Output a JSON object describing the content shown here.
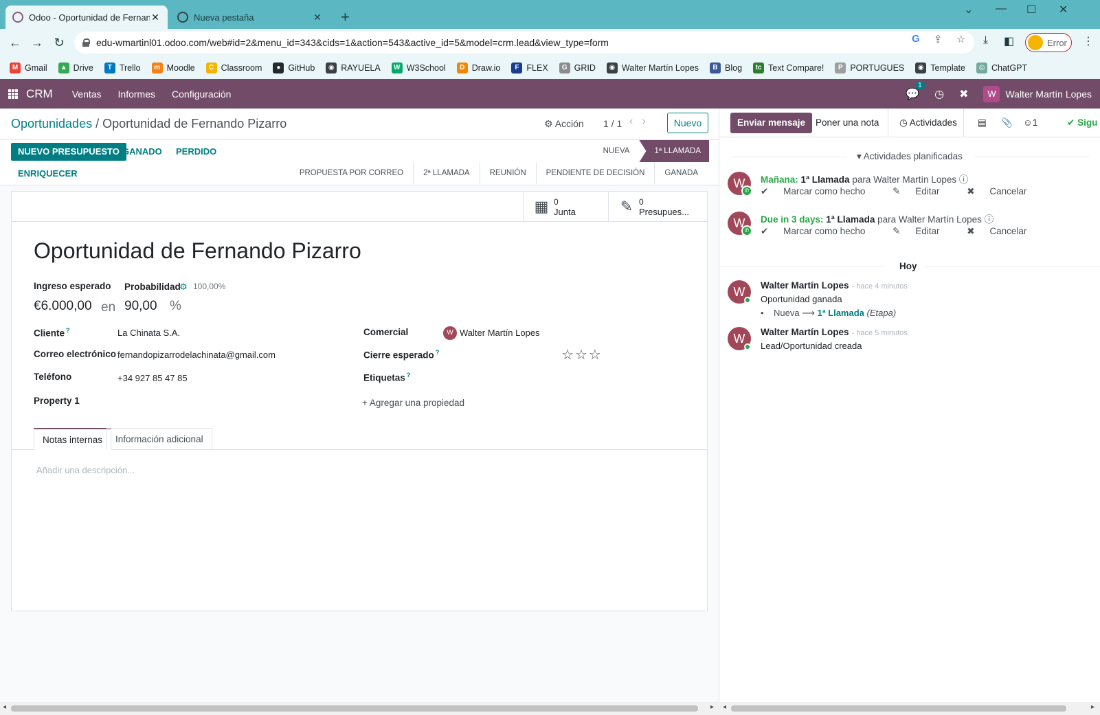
{
  "browser": {
    "tabs": [
      {
        "title": "Odoo - Oportunidad de Fernando Pizarro",
        "active": true
      },
      {
        "title": "Nueva pestaña",
        "active": false
      }
    ],
    "url": "edu-wmartinl01.odoo.com/web#id=2&menu_id=343&cids=1&action=543&active_id=5&model=crm.lead&view_type=form",
    "profile_label": "Error",
    "bookmarks": [
      {
        "label": "Gmail",
        "icon": "gmail-icon",
        "color": "#ea4335",
        "glyph": "M"
      },
      {
        "label": "Drive",
        "icon": "drive-icon",
        "color": "#34a853",
        "glyph": "▲"
      },
      {
        "label": "Trello",
        "icon": "trello-icon",
        "color": "#0079bf",
        "glyph": "T"
      },
      {
        "label": "Moodle",
        "icon": "moodle-icon",
        "color": "#f98012",
        "glyph": "m"
      },
      {
        "label": "Classroom",
        "icon": "classroom-icon",
        "color": "#f4b400",
        "glyph": "C"
      },
      {
        "label": "GitHub",
        "icon": "github-icon",
        "color": "#24292e",
        "glyph": "●"
      },
      {
        "label": "RAYUELA",
        "icon": "rayuela-icon",
        "color": "#3c4043",
        "glyph": "◉"
      },
      {
        "label": "W3School",
        "icon": "w3school-icon",
        "color": "#04aa6d",
        "glyph": "W"
      },
      {
        "label": "Draw.io",
        "icon": "drawio-icon",
        "color": "#f08705",
        "glyph": "D"
      },
      {
        "label": "FLEX",
        "icon": "flex-icon",
        "color": "#1a3d8f",
        "glyph": "F"
      },
      {
        "label": "GRID",
        "icon": "grid-icon",
        "color": "#8c8c8c",
        "glyph": "G"
      },
      {
        "label": "Walter Martín Lopes",
        "icon": "globe-icon",
        "color": "#3c4043",
        "glyph": "◉"
      },
      {
        "label": "Blog",
        "icon": "blog-icon",
        "color": "#3b5998",
        "glyph": "B"
      },
      {
        "label": "Text Compare!",
        "icon": "textcompare-icon",
        "color": "#2e7d32",
        "glyph": "tc"
      },
      {
        "label": "PORTUGUES",
        "icon": "portugues-icon",
        "color": "#9e9e9e",
        "glyph": "P"
      },
      {
        "label": "Template",
        "icon": "template-icon",
        "color": "#3c4043",
        "glyph": "◉"
      },
      {
        "label": "ChatGPT",
        "icon": "chatgpt-icon",
        "color": "#74aa9c",
        "glyph": "◎"
      }
    ]
  },
  "navbar": {
    "app": "CRM",
    "menus": [
      "Ventas",
      "Informes",
      "Configuración"
    ],
    "chat_badge": "1",
    "user_initial": "W",
    "user_name": "Walter Martín Lopes"
  },
  "control_panel": {
    "breadcrumb_parent": "Oportunidades",
    "breadcrumb_sep": "/",
    "breadcrumb_current": "Oportunidad de Fernando Pizarro",
    "action_label": "Acción",
    "pager": "1 / 1",
    "new_label": "Nuevo"
  },
  "statusbar": {
    "buttons": {
      "quote": "NUEVO PRESUPUESTO",
      "won": "GANADO",
      "lost": "PERDIDO",
      "enrich": "ENRIQUECER"
    },
    "stages_top": [
      "NUEVA",
      "1ª LLAMADA"
    ],
    "stages_bottom": [
      "PROPUESTA POR CORREO",
      "2ª LLAMADA",
      "REUNIÓN",
      "PENDIENTE DE DECISIÓN",
      "GANADA"
    ],
    "current_stage": "1ª LLAMADA",
    "current_color": "#714b67"
  },
  "smart_buttons": [
    {
      "value": "0",
      "label": "Junta",
      "icon": "calendar-icon"
    },
    {
      "value": "0",
      "label": "Presupues...",
      "icon": "edit-icon"
    }
  ],
  "form": {
    "title": "Oportunidad de Fernando Pizarro",
    "expected_revenue_label": "Ingreso esperado",
    "expected_revenue": "€6.000,00",
    "in_label": "en",
    "probability_label": "Probabilidad",
    "probability_auto": "100,00%",
    "probability": "90,00",
    "percent": "%",
    "customer_label": "Cliente",
    "customer": "La Chinata S.A.",
    "email_label": "Correo electrónico",
    "email": "fernandopizarrodelachinata@gmail.com",
    "phone_label": "Teléfono",
    "phone": "+34 927 85 47 85",
    "property_label": "Property 1",
    "salesperson_label": "Comercial",
    "salesperson_initial": "W",
    "salesperson": "Walter Martín Lopes",
    "deadline_label": "Cierre esperado",
    "tags_label": "Etiquetas",
    "add_property": "Agregar una propiedad",
    "priority_stars": 0,
    "tabs": [
      "Notas internas",
      "Información adicional"
    ],
    "description_placeholder": "Añadir una descripción..."
  },
  "chatter": {
    "send_message": "Enviar mensaje",
    "log_note": "Poner una nota",
    "activities": "Actividades",
    "followers_count": "1",
    "follow_label": "Sigu",
    "planned_header": "Actividades planificadas",
    "activities_list": [
      {
        "when": "Mañana:",
        "summary": "1ª Llamada",
        "for": "para Walter Martín Lopes",
        "done": "Marcar como hecho",
        "edit": "Editar",
        "cancel": "Cancelar",
        "initial": "W"
      },
      {
        "when": "Due in 3 days:",
        "summary": "1ª Llamada",
        "for": "para Walter Martín Lopes",
        "done": "Marcar como hecho",
        "edit": "Editar",
        "cancel": "Cancelar",
        "initial": "W"
      }
    ],
    "today_label": "Hoy",
    "messages": [
      {
        "author": "Walter Martín Lopes",
        "ago": "- hace 4 minutos",
        "body": "Oportunidad ganada",
        "track_from": "Nueva",
        "track_to": "1ª Llamada",
        "track_field": "(Etapa)",
        "initial": "W"
      },
      {
        "author": "Walter Martín Lopes",
        "ago": "- hace 5 minutos",
        "body": "Lead/Oportunidad creada",
        "initial": "W"
      }
    ]
  }
}
